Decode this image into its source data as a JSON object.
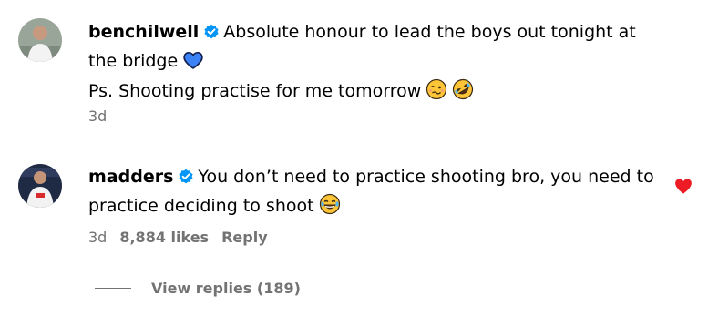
{
  "comments": [
    {
      "username": "benchilwell",
      "line1": "Absolute honour to lead the boys out tonight at the bridge",
      "line2": "Ps. Shooting practise for me tomorrow",
      "time": "3d",
      "emojis": [
        "blue-heart",
        "woozy-face",
        "rofl-face"
      ]
    },
    {
      "username": "madders",
      "text": "You don’t need to practice shooting bro, you need to practice deciding to shoot",
      "time": "3d",
      "likes": "8,884 likes",
      "reply_label": "Reply",
      "emojis": [
        "tears-of-joy-face"
      ]
    }
  ],
  "view_replies": "View replies (189)",
  "colors": {
    "verified": "#0095f6",
    "meta_text": "#737373",
    "like_heart": "#ed1c24"
  }
}
